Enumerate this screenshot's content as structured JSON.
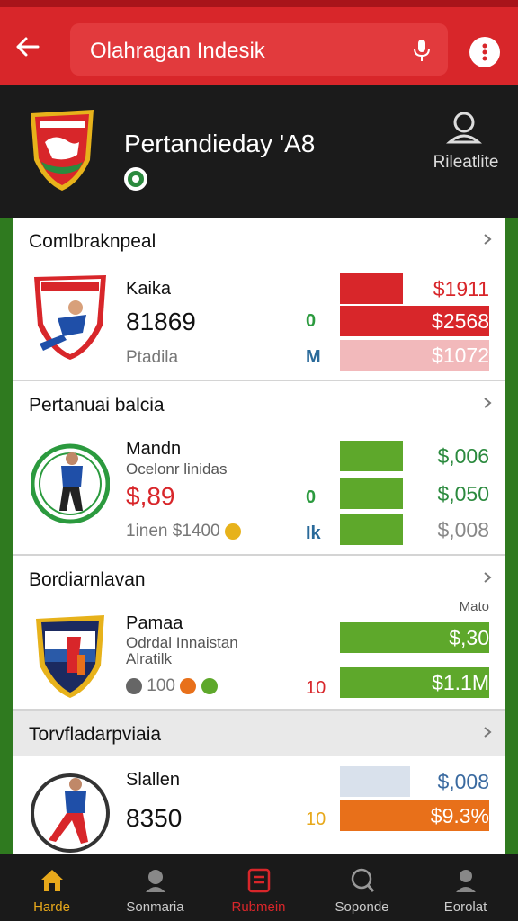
{
  "search": {
    "query": "Olahragan Indesik"
  },
  "header": {
    "title": "Pertandieday 'A8",
    "profile_label": "Rileatlite"
  },
  "cards": [
    {
      "title": "Comlbraknpeal",
      "team_name": "Kaika",
      "team_value": "81869",
      "team_foot": "Ptadila",
      "mark_top": "0",
      "mark_bottom": "M",
      "prices": [
        "$1911",
        "$2568",
        "$1072"
      ],
      "accent": "#d8262a"
    },
    {
      "title": "Pertanuai balcia",
      "team_name": "Mandn",
      "team_sub": "Ocelonr linidas",
      "team_value": "$,89",
      "team_foot": "1inen $1400",
      "mark_top": "0",
      "mark_bottom": "Ik",
      "prices": [
        "$,006",
        "$,050",
        "$,008"
      ],
      "accent": "#5ea82b"
    },
    {
      "title": "Bordiarnlavan",
      "note": "Mato",
      "team_name": "Pamaa",
      "team_sub": "Odrdal Innaistan Alratilk",
      "team_foot": "100",
      "mark_bottom": "10",
      "prices": [
        "$,30",
        "$1.1M"
      ]
    },
    {
      "title": "Torvfladarpviaia",
      "team_name": "Slallen",
      "team_value": "8350",
      "mark_bottom": "10",
      "prices": [
        "$,008",
        "$9.3%"
      ]
    }
  ],
  "nav": [
    {
      "label": "Harde",
      "icon": "home-icon"
    },
    {
      "label": "Sonmaria",
      "icon": "person-icon"
    },
    {
      "label": "Rubmein",
      "icon": "document-icon"
    },
    {
      "label": "Soponde",
      "icon": "search-icon"
    },
    {
      "label": "Eorolat",
      "icon": "profile-icon"
    }
  ],
  "colors": {
    "brand_red": "#d8262a",
    "header_dark": "#1b1b1b",
    "green": "#5ea82b",
    "orange": "#e8701a",
    "nav_active": "#d8262a"
  }
}
